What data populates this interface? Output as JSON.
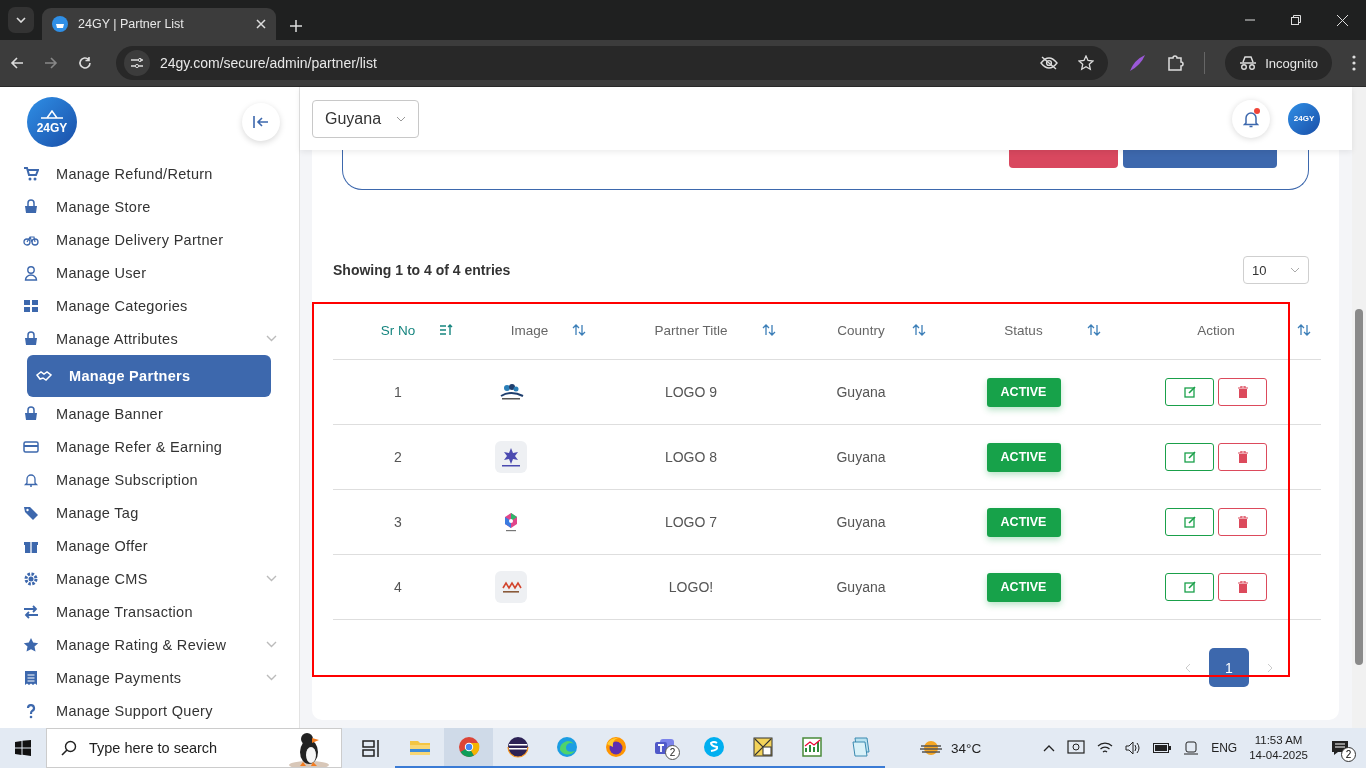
{
  "browser": {
    "tab_title": "24GY | Partner List",
    "url": "24gy.com/secure/admin/partner/list",
    "profile_label": "Incognito"
  },
  "sidebar": {
    "logo_text": "24GY",
    "items": [
      {
        "label": "Manage Refund/Return",
        "selected": false,
        "has_submenu": false
      },
      {
        "label": "Manage Store",
        "selected": false,
        "has_submenu": false
      },
      {
        "label": "Manage Delivery Partner",
        "selected": false,
        "has_submenu": false
      },
      {
        "label": "Manage User",
        "selected": false,
        "has_submenu": false
      },
      {
        "label": "Manage Categories",
        "selected": false,
        "has_submenu": false
      },
      {
        "label": "Manage Attributes",
        "selected": false,
        "has_submenu": true
      },
      {
        "label": "Manage Partners",
        "selected": true,
        "has_submenu": false
      },
      {
        "label": "Manage Banner",
        "selected": false,
        "has_submenu": false
      },
      {
        "label": "Manage Refer & Earning",
        "selected": false,
        "has_submenu": false
      },
      {
        "label": "Manage Subscription",
        "selected": false,
        "has_submenu": false
      },
      {
        "label": "Manage Tag",
        "selected": false,
        "has_submenu": false
      },
      {
        "label": "Manage Offer",
        "selected": false,
        "has_submenu": false
      },
      {
        "label": "Manage CMS",
        "selected": false,
        "has_submenu": true
      },
      {
        "label": "Manage Transaction",
        "selected": false,
        "has_submenu": false
      },
      {
        "label": "Manage Rating & Review",
        "selected": false,
        "has_submenu": true
      },
      {
        "label": "Manage Payments",
        "selected": false,
        "has_submenu": true
      },
      {
        "label": "Manage Support Query",
        "selected": false,
        "has_submenu": false
      }
    ]
  },
  "header": {
    "country": "Guyana",
    "avatar_text": "24GY",
    "has_notification": true
  },
  "entries_info": "Showing 1 to 4 of 4 entries",
  "page_size": "10",
  "table": {
    "columns": [
      {
        "label": "Sr No",
        "selected": true
      },
      {
        "label": "Image",
        "selected": false
      },
      {
        "label": "Partner Title",
        "selected": false
      },
      {
        "label": "Country",
        "selected": false
      },
      {
        "label": "Status",
        "selected": false
      },
      {
        "label": "Action",
        "selected": false
      }
    ],
    "rows": [
      {
        "sr_no": "1",
        "title": "LOGO 9",
        "country": "Guyana",
        "status": "ACTIVE"
      },
      {
        "sr_no": "2",
        "title": "LOGO 8",
        "country": "Guyana",
        "status": "ACTIVE"
      },
      {
        "sr_no": "3",
        "title": "LOGO 7",
        "country": "Guyana",
        "status": "ACTIVE"
      },
      {
        "sr_no": "4",
        "title": "LOGO!",
        "country": "Guyana",
        "status": "ACTIVE"
      }
    ]
  },
  "pagination": {
    "pages": [
      {
        "label": "1",
        "selected": true
      }
    ]
  },
  "taskbar": {
    "search_placeholder": "Type here to search",
    "apps": [
      {
        "running": false,
        "selected": false
      },
      {
        "running": true,
        "selected": false
      },
      {
        "running": true,
        "selected": true
      },
      {
        "running": true,
        "selected": false
      },
      {
        "running": true,
        "selected": false
      },
      {
        "running": true,
        "selected": false
      },
      {
        "running": true,
        "selected": false,
        "badge": "2"
      },
      {
        "running": true,
        "selected": false
      },
      {
        "running": true,
        "selected": false
      },
      {
        "running": true,
        "selected": false
      },
      {
        "running": true,
        "selected": false
      }
    ],
    "weather": "34°C",
    "language": "ENG",
    "time": "11:53 AM",
    "date": "14-04-2025",
    "notifications": "2"
  }
}
